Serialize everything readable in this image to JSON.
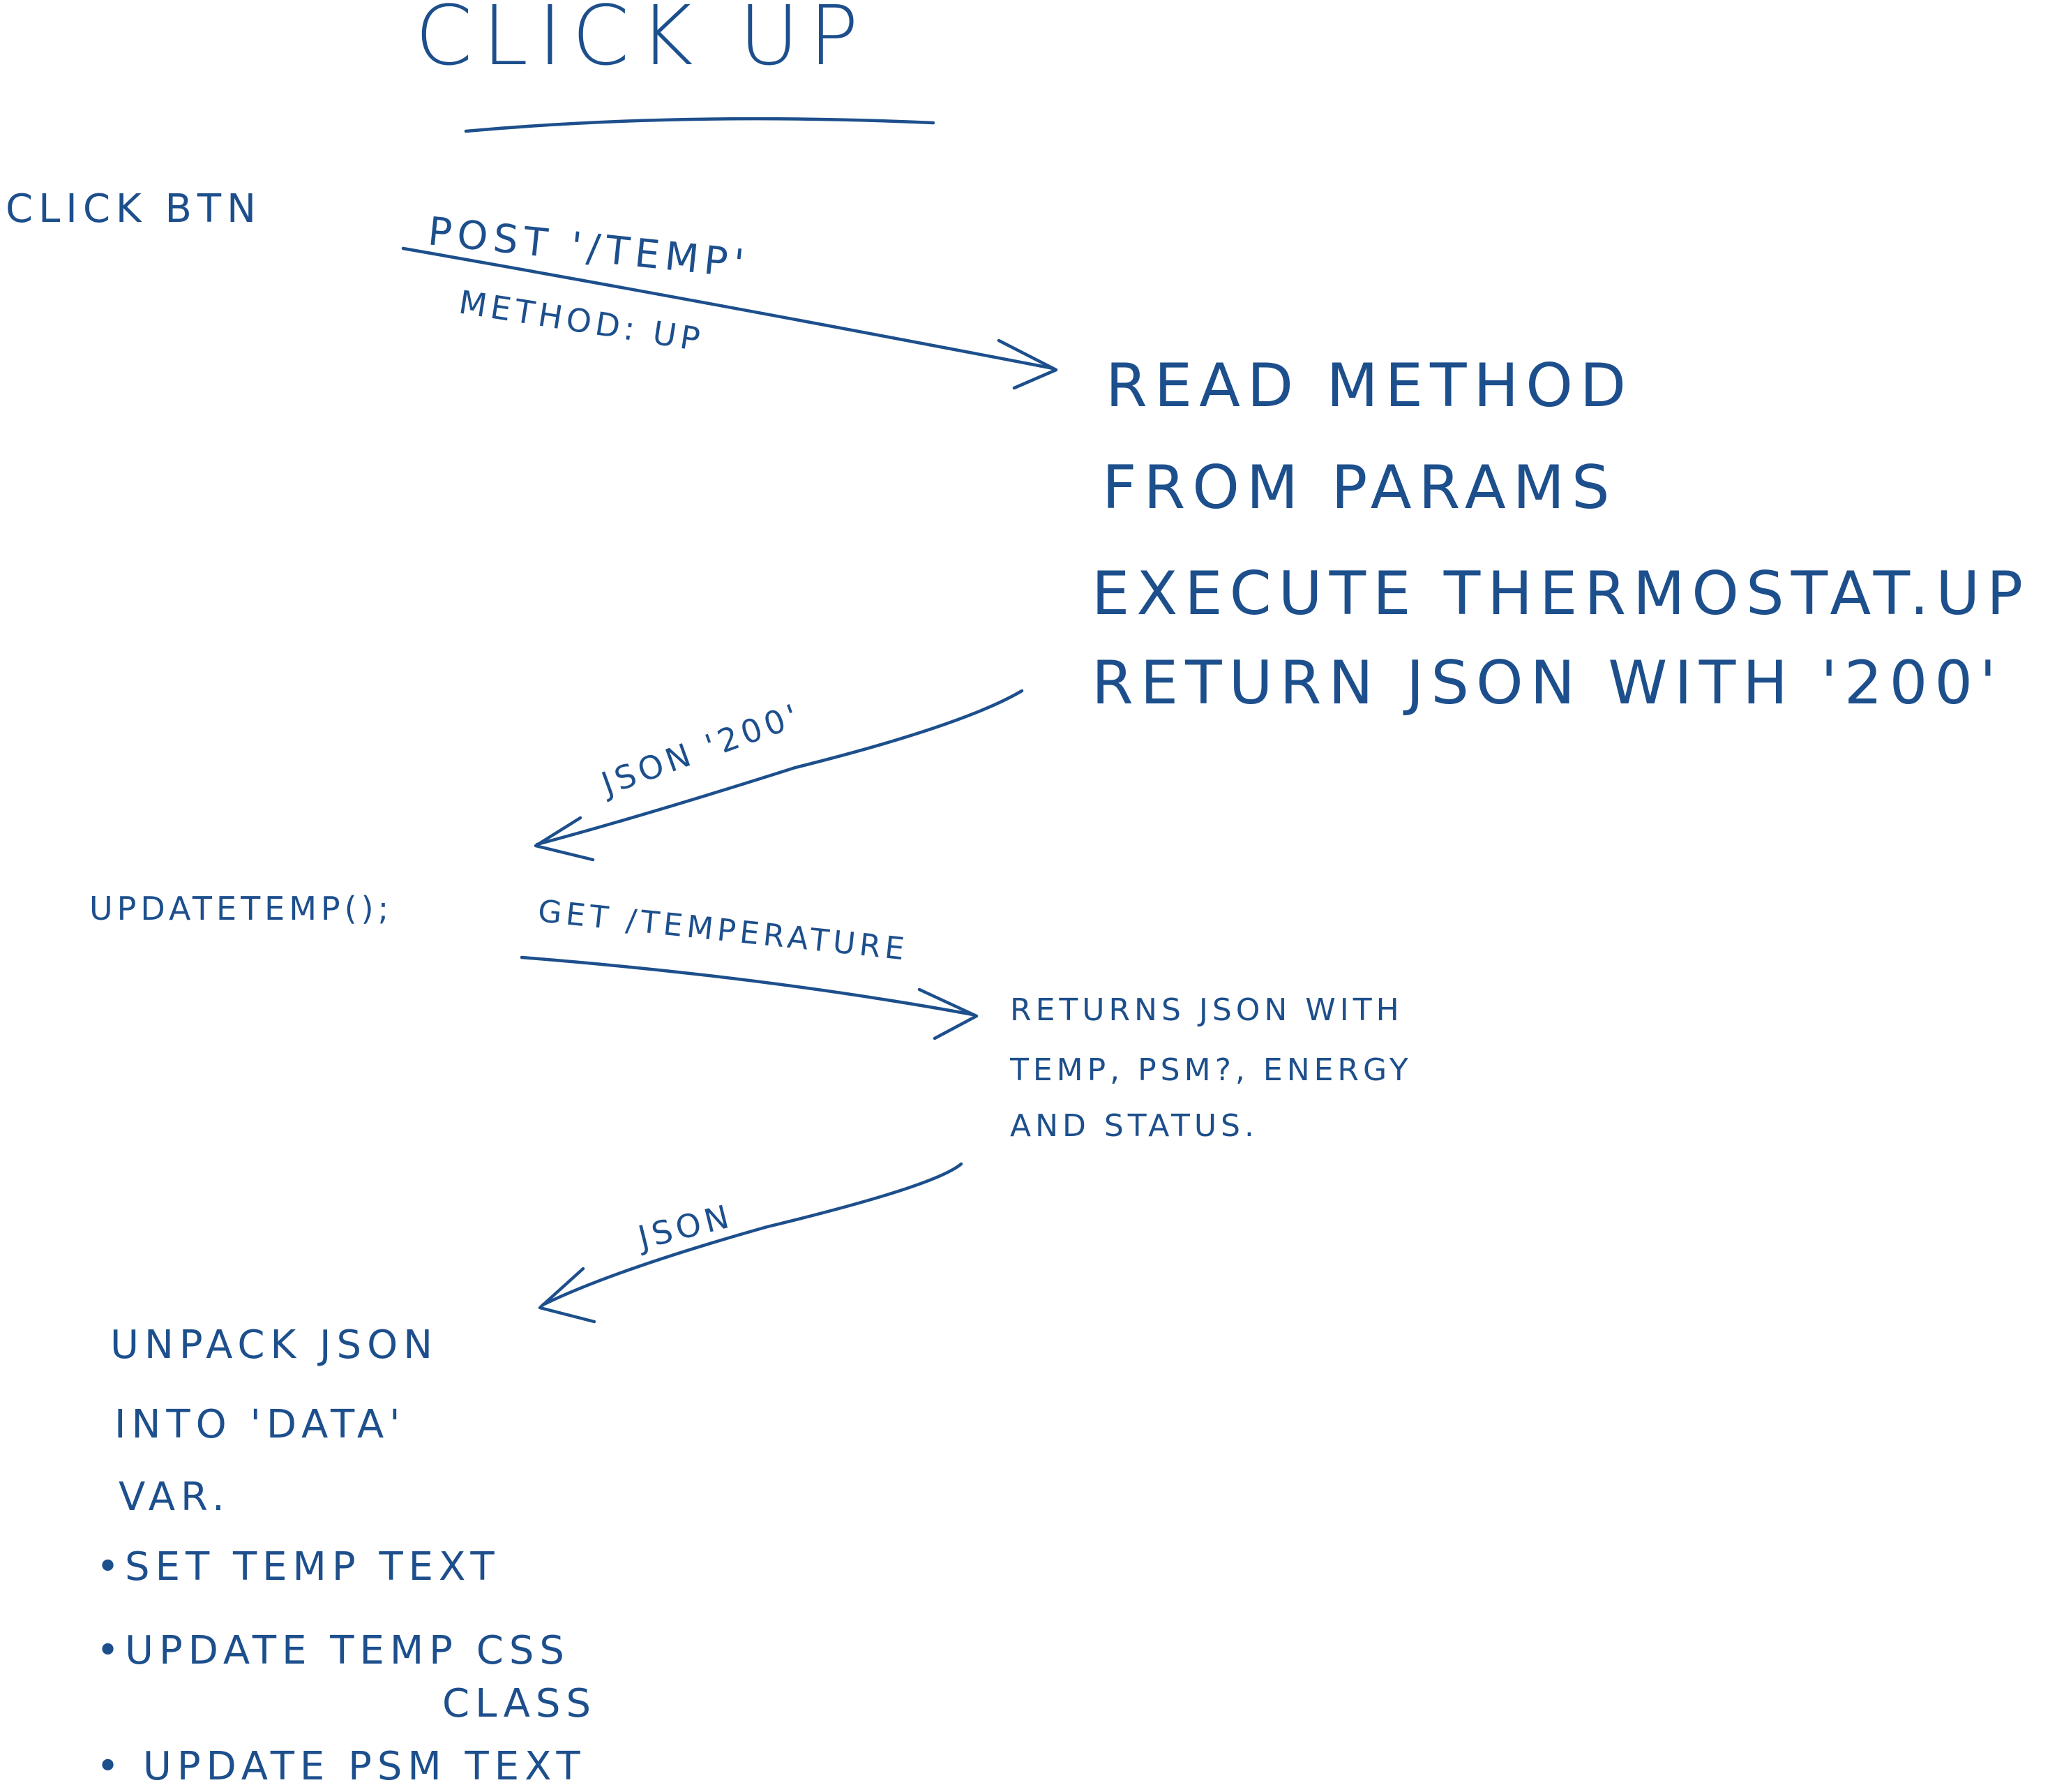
{
  "title": "CLICK UP",
  "client": {
    "click_btn": "CLICK BTN",
    "update_temp_call": "UPDATETEMP();",
    "unpack_steps": [
      "UNPACK JSON",
      "INTO 'DATA'",
      "VAR.",
      "•SET TEMP TEXT",
      "•UPDATE TEMP CSS",
      "CLASS",
      "• UPDATE PSM TEXT"
    ]
  },
  "requests": {
    "post_label": "POST '/TEMP'",
    "post_method": "METHOD: UP",
    "json_200": "JSON '200'",
    "get_label": "GET /TEMPERATURE",
    "json_plain": "JSON"
  },
  "server": {
    "up_handler_steps": [
      "READ METHOD",
      "FROM PARAMS",
      "EXECUTE THERMOSTAT.UP",
      "RETURN JSON WITH '200'"
    ],
    "temperature_handler_steps": [
      "RETURNS JSON WITH",
      "TEMP, PSM?, ENERGY",
      "AND STATUS."
    ]
  },
  "colors": {
    "ink": "#1d4f8c",
    "paper": "#ffffff"
  }
}
